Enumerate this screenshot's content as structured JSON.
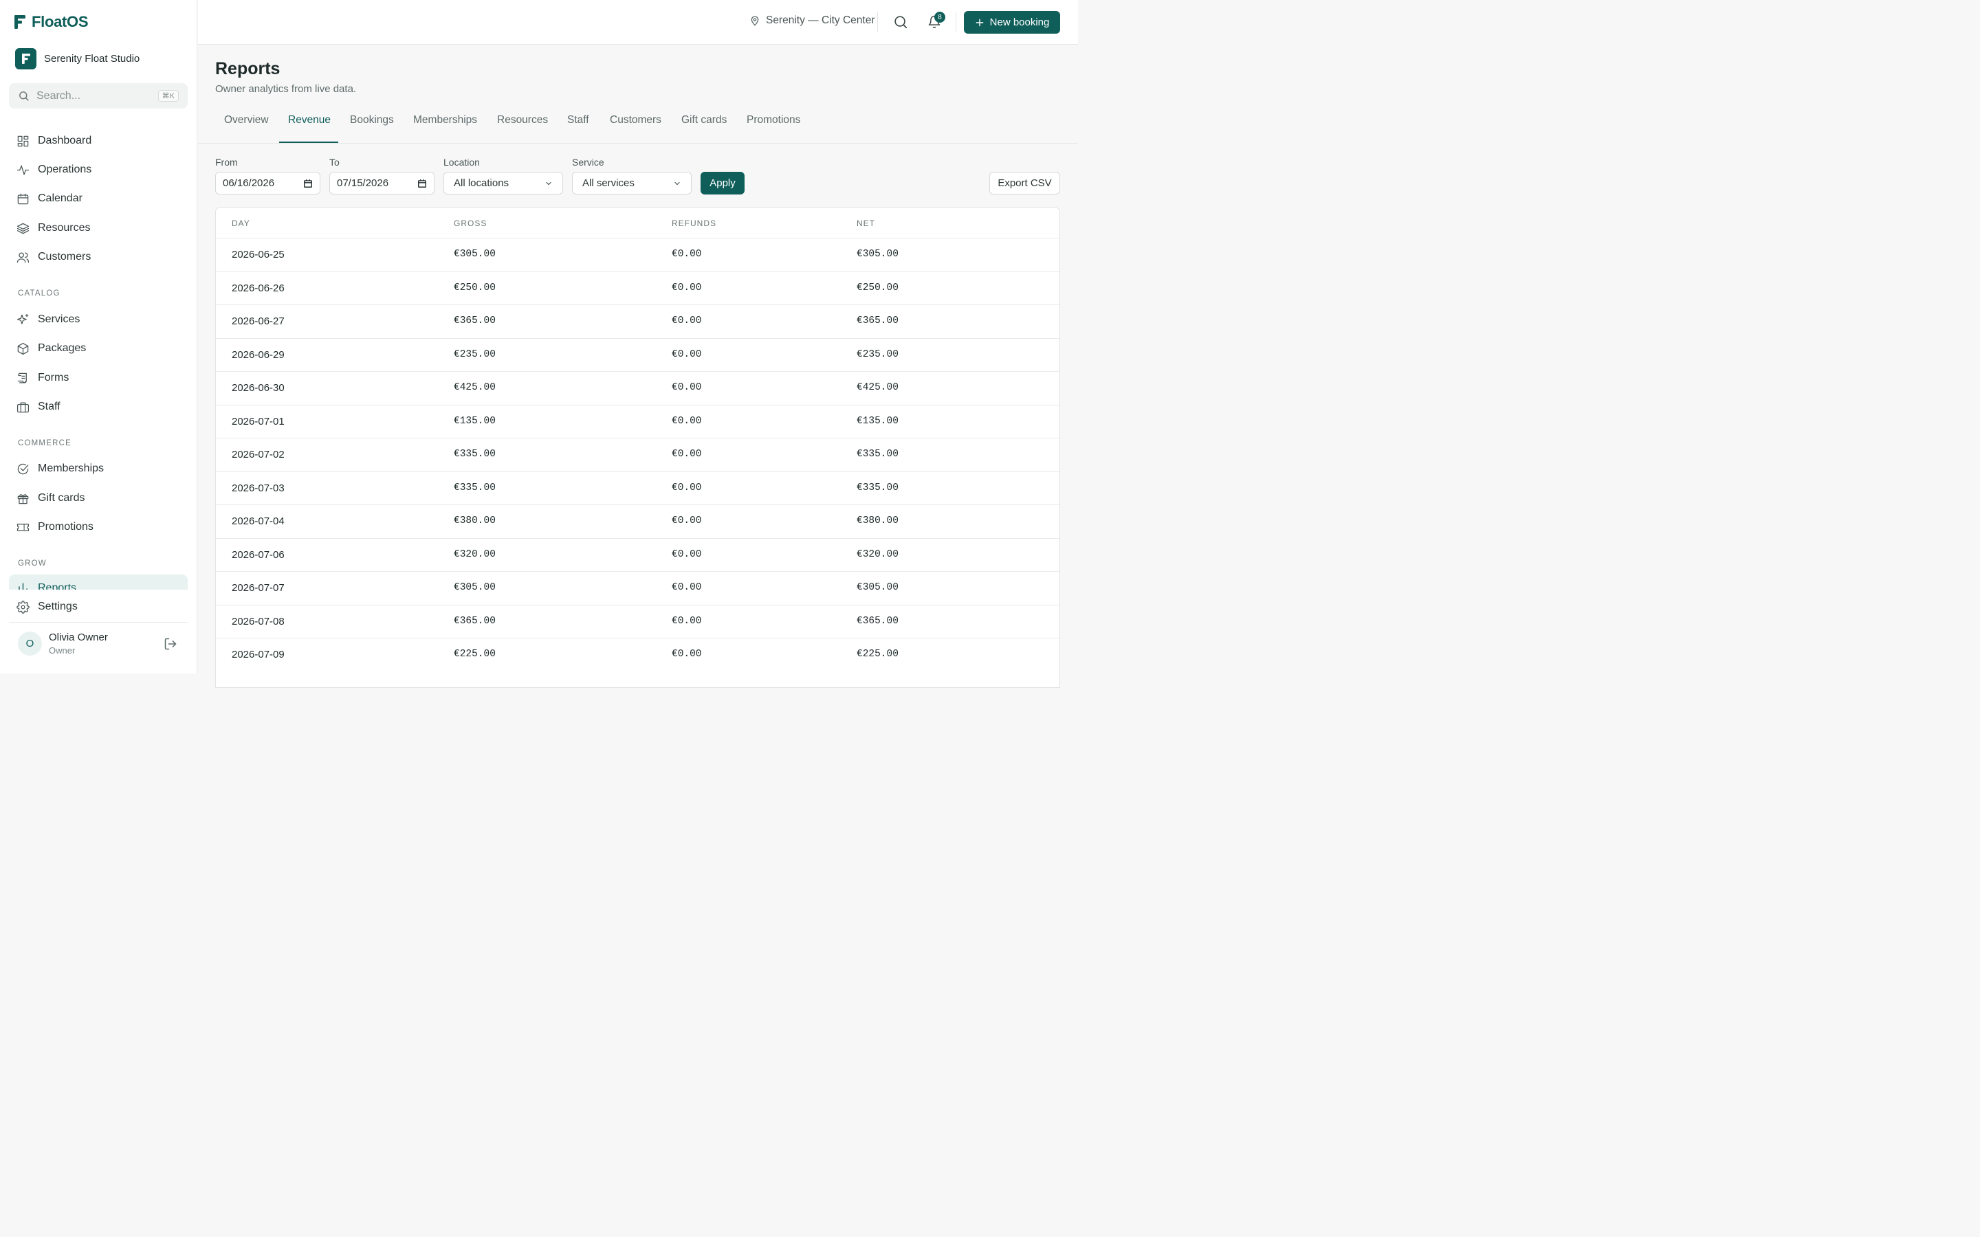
{
  "app": {
    "brand": "FloatOS",
    "studio": "Serenity Float Studio"
  },
  "search": {
    "placeholder": "Search...",
    "shortcut": "⌘K"
  },
  "nav": {
    "main": [
      "Dashboard",
      "Operations",
      "Calendar",
      "Resources",
      "Customers"
    ],
    "catalog_label": "CATALOG",
    "catalog": [
      "Services",
      "Packages",
      "Forms",
      "Staff"
    ],
    "commerce_label": "COMMERCE",
    "commerce": [
      "Memberships",
      "Gift cards",
      "Promotions"
    ],
    "grow_label": "GROW",
    "grow": [
      "Reports"
    ],
    "settings": "Settings"
  },
  "user": {
    "name": "Olivia Owner",
    "role": "Owner",
    "initial": "O"
  },
  "topbar": {
    "location": "Serenity — City Center",
    "notifications": "8",
    "new_booking": "New booking"
  },
  "page": {
    "title": "Reports",
    "subtitle": "Owner analytics from live data."
  },
  "tabs": [
    "Overview",
    "Revenue",
    "Bookings",
    "Memberships",
    "Resources",
    "Staff",
    "Customers",
    "Gift cards",
    "Promotions"
  ],
  "active_tab": "Revenue",
  "filters": {
    "from_label": "From",
    "from_value": "06/16/2026",
    "to_label": "To",
    "to_value": "07/15/2026",
    "location_label": "Location",
    "location_value": "All locations",
    "service_label": "Service",
    "service_value": "All services",
    "apply": "Apply",
    "export": "Export CSV"
  },
  "table": {
    "headers": [
      "DAY",
      "GROSS",
      "REFUNDS",
      "NET"
    ],
    "rows": [
      [
        "2026-06-25",
        "€305.00",
        "€0.00",
        "€305.00"
      ],
      [
        "2026-06-26",
        "€250.00",
        "€0.00",
        "€250.00"
      ],
      [
        "2026-06-27",
        "€365.00",
        "€0.00",
        "€365.00"
      ],
      [
        "2026-06-29",
        "€235.00",
        "€0.00",
        "€235.00"
      ],
      [
        "2026-06-30",
        "€425.00",
        "€0.00",
        "€425.00"
      ],
      [
        "2026-07-01",
        "€135.00",
        "€0.00",
        "€135.00"
      ],
      [
        "2026-07-02",
        "€335.00",
        "€0.00",
        "€335.00"
      ],
      [
        "2026-07-03",
        "€335.00",
        "€0.00",
        "€335.00"
      ],
      [
        "2026-07-04",
        "€380.00",
        "€0.00",
        "€380.00"
      ],
      [
        "2026-07-06",
        "€320.00",
        "€0.00",
        "€320.00"
      ],
      [
        "2026-07-07",
        "€305.00",
        "€0.00",
        "€305.00"
      ],
      [
        "2026-07-08",
        "€365.00",
        "€0.00",
        "€365.00"
      ],
      [
        "2026-07-09",
        "€225.00",
        "€0.00",
        "€225.00"
      ]
    ]
  },
  "colors": {
    "accent": "#0f5e5a",
    "active_bg": "#e8f2f1"
  }
}
